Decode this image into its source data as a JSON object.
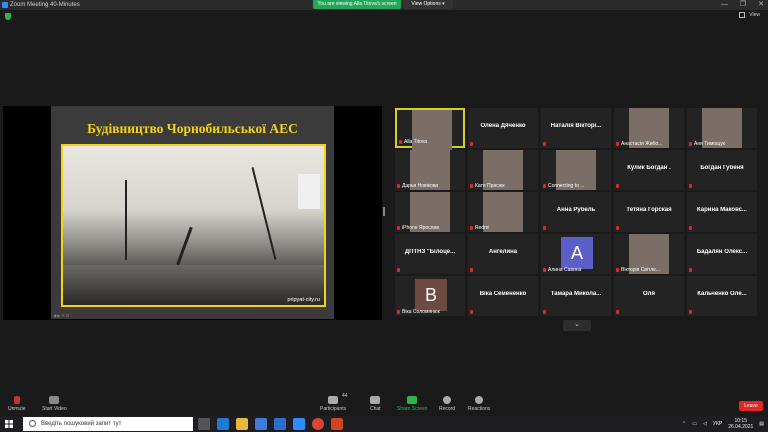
{
  "window": {
    "title": "Zoom Meeting 40-Minutes",
    "controls": [
      "—",
      "❐",
      "✕"
    ]
  },
  "banner": {
    "text": "You are viewing Alla Titova's screen",
    "view_options": "View Options ▾"
  },
  "topbar": {
    "view_label": "View"
  },
  "slide": {
    "title": "Будівництво Чорнобильської АЕС",
    "caption": "pripyat-city.ru"
  },
  "gallery": {
    "tiles": [
      {
        "name": "Alla Titova",
        "type": "video",
        "active": true
      },
      {
        "name": "Олена Дяченко",
        "type": "name"
      },
      {
        "name": "Наталія Вікторі...",
        "type": "name"
      },
      {
        "name": "Анастасія Жибо...",
        "type": "video"
      },
      {
        "name": "Аня Тимощук",
        "type": "video"
      },
      {
        "name": "Дарья Новікова",
        "type": "video"
      },
      {
        "name": "Катя Прасюк",
        "type": "video"
      },
      {
        "name": "Connecting to ...",
        "type": "video"
      },
      {
        "name": "Кулик Богдан .",
        "type": "name"
      },
      {
        "name": "Богдан Губеня",
        "type": "name"
      },
      {
        "name": "iPhone Ярослав",
        "type": "video"
      },
      {
        "name": "Redmi",
        "type": "video"
      },
      {
        "name": "Анна Рубель",
        "type": "name"
      },
      {
        "name": "Тетяна Горская",
        "type": "name"
      },
      {
        "name": "Карина Маковс...",
        "type": "name"
      },
      {
        "name": "ДПТНЗ \"Білоце...",
        "type": "name"
      },
      {
        "name": "Ангелина",
        "type": "name"
      },
      {
        "name": "Алина Савина",
        "type": "avatar",
        "letter": "A",
        "color": "#5b5fc7"
      },
      {
        "name": "Вікторія Світле...",
        "type": "video"
      },
      {
        "name": "Бадалян Олекс...",
        "type": "name"
      },
      {
        "name": "Віка Соломянюк",
        "type": "avatar",
        "letter": "B",
        "color": "#6b4a3f"
      },
      {
        "name": "Віка Семененко",
        "type": "name"
      },
      {
        "name": "Тамара Микола...",
        "type": "name"
      },
      {
        "name": "Оля",
        "type": "name"
      },
      {
        "name": "Кальченко Оле...",
        "type": "name"
      }
    ]
  },
  "toolbar": {
    "unmute": "Unmute",
    "start_video": "Start Video",
    "participants": "Participants",
    "participants_count": "44",
    "chat": "Chat",
    "share_screen": "Share Screen",
    "record": "Record",
    "reactions": "Reactions",
    "leave": "Leave"
  },
  "taskbar": {
    "search_placeholder": "Введіть пошуковий запит тут",
    "lang": "УКР",
    "time": "10:15",
    "date": "26.04.2021"
  },
  "colors": {
    "accent_green": "#23a55a",
    "leave_red": "#e02828",
    "slide_yellow": "#f2d21b",
    "active_border": "#d6cf2a"
  }
}
